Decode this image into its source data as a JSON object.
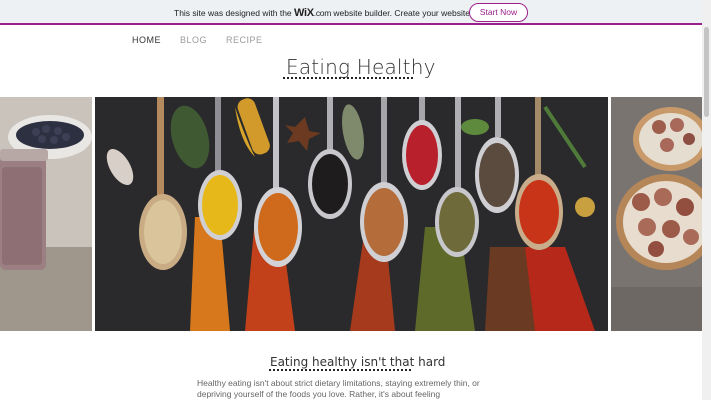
{
  "banner": {
    "text_before": "This site was designed with the ",
    "logo_wix": "WiX",
    "logo_com": ".com",
    "text_after": " website builder. Create your website today.",
    "button_label": "Start Now",
    "accent_color": "#9a1f8a"
  },
  "nav": {
    "items": [
      {
        "label": "HOME"
      },
      {
        "label": "BLOG"
      },
      {
        "label": "RECIPE"
      }
    ]
  },
  "site": {
    "title": "Eating Healthy"
  },
  "gallery": {
    "left_image": "smoothie-and-blueberries-photo",
    "main_image": "spices-on-spoons-photo",
    "right_image": "fig-toast-photo"
  },
  "section": {
    "title": "Eating healthy isn't that hard",
    "body": "Healthy eating isn't about strict dietary limitations, staying extremely thin, or depriving yourself of the foods you love. Rather, it's about feeling"
  }
}
